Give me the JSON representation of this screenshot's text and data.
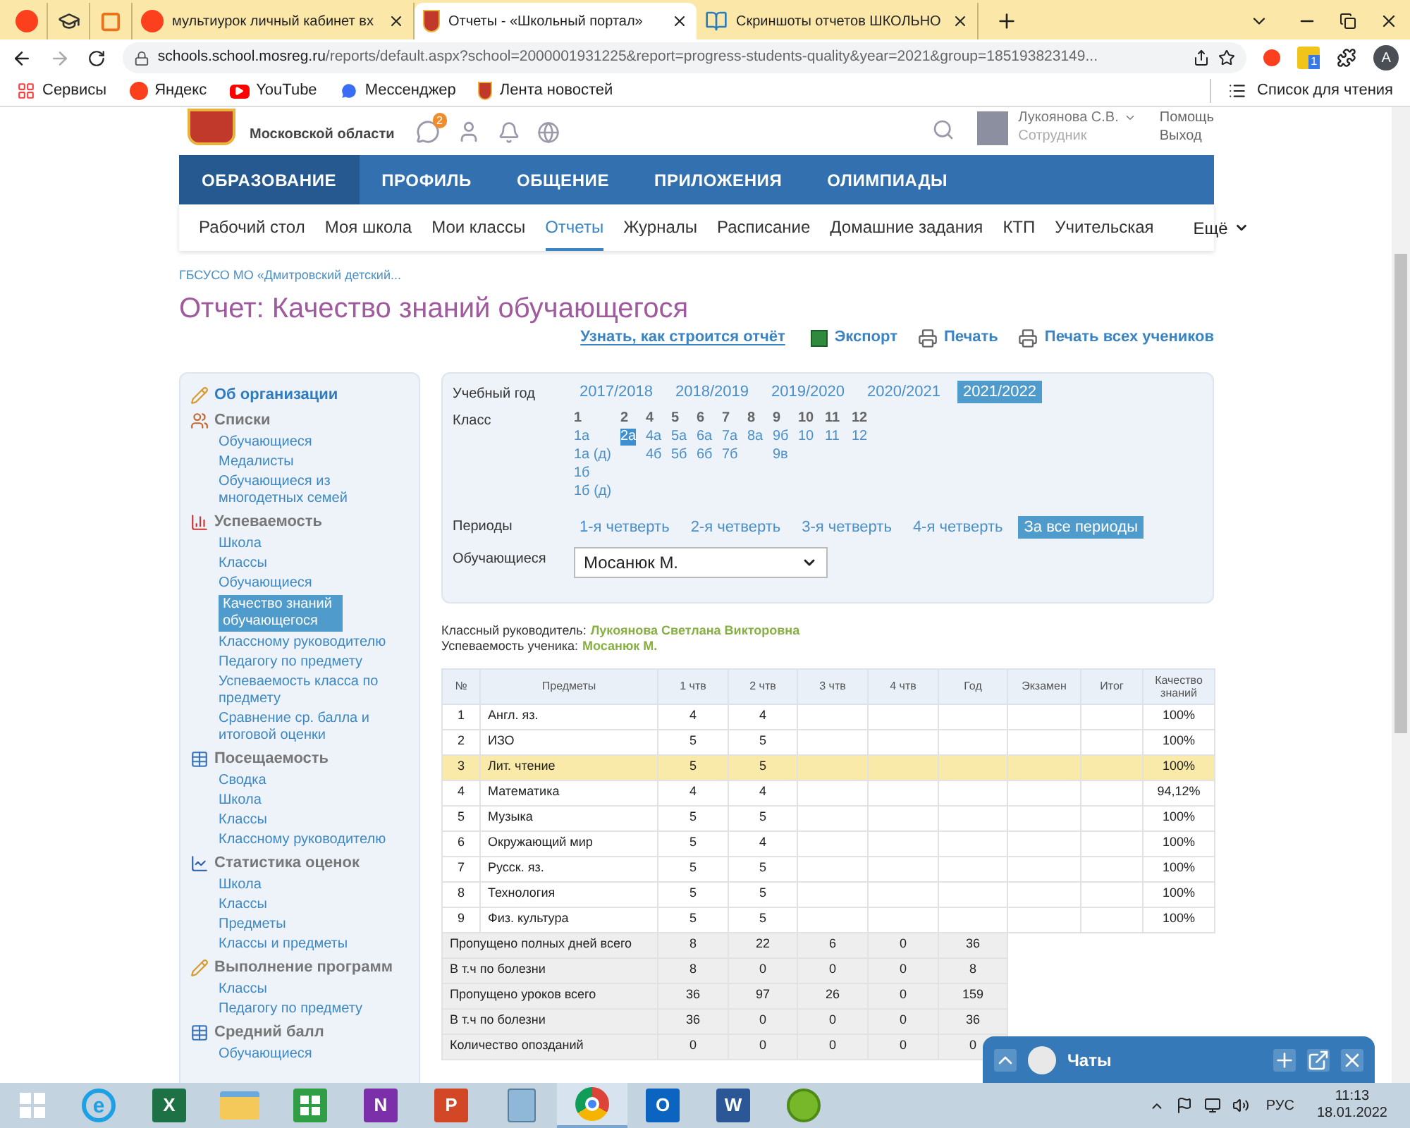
{
  "browser": {
    "tabs": [
      {
        "selected": false
      },
      {
        "selected": false
      },
      {
        "selected": false
      },
      {
        "title": "мультиурок личный кабинет вх",
        "selected": false
      },
      {
        "title": "Отчеты - «Школьный портал»",
        "selected": true
      },
      {
        "title": "Скриншоты отчетов ШКОЛЬНО",
        "selected": false
      }
    ],
    "address": {
      "host": "schools.school.mosreg.ru",
      "path": "/reports/default.aspx?school=2000001931225&report=progress-students-quality&year=2021&group=185193823149..."
    },
    "extension_badge": "1",
    "profile_letter": "A",
    "bookmarks": [
      "Сервисы",
      "Яндекс",
      "YouTube",
      "Мессенджер",
      "Лента новостей"
    ],
    "reading_list": "Список для чтения"
  },
  "header": {
    "region": "Московской области",
    "chat_badge": "2",
    "user": "Лукоянова С.В.",
    "role": "Сотрудник",
    "links": [
      "Помощь",
      "Выход"
    ]
  },
  "nav": [
    {
      "label": "ОБРАЗОВАНИЕ",
      "selected": true
    },
    {
      "label": "ПРОФИЛЬ",
      "selected": false
    },
    {
      "label": "ОБЩЕНИЕ",
      "selected": false
    },
    {
      "label": "ПРИЛОЖЕНИЯ",
      "selected": false
    },
    {
      "label": "ОЛИМПИАДЫ",
      "selected": false
    }
  ],
  "subnav": [
    {
      "label": "Рабочий стол",
      "selected": false
    },
    {
      "label": "Моя школа",
      "selected": false
    },
    {
      "label": "Мои классы",
      "selected": false
    },
    {
      "label": "Отчеты",
      "selected": true
    },
    {
      "label": "Журналы",
      "selected": false
    },
    {
      "label": "Расписание",
      "selected": false
    },
    {
      "label": "Домашние задания",
      "selected": false
    },
    {
      "label": "КТП",
      "selected": false
    },
    {
      "label": "Учительская",
      "selected": false
    }
  ],
  "subnav_more": "Ещё",
  "breadcrumb": "ГБСУСО МО «Дмитровский детский...",
  "title": "Отчет: Качество знаний обучающегося",
  "actions": [
    {
      "kind": "link",
      "label": "Узнать, как строится отчёт"
    },
    {
      "kind": "export",
      "label": "Экспорт"
    },
    {
      "kind": "print",
      "label": "Печать"
    },
    {
      "kind": "print",
      "label": "Печать всех учеников"
    }
  ],
  "sidebar": [
    {
      "kind": "link",
      "title": "Об организации"
    },
    {
      "kind": "group",
      "title": "Списки",
      "items": [
        {
          "label": "Обучающиеся",
          "selected": false
        },
        {
          "label": "Медалисты",
          "selected": false
        },
        {
          "label": "Обучающиеся из многодетных семей",
          "selected": false
        }
      ]
    },
    {
      "kind": "group",
      "title": "Успеваемость",
      "items": [
        {
          "label": "Школа",
          "selected": false
        },
        {
          "label": "Классы",
          "selected": false
        },
        {
          "label": "Обучающиеся",
          "selected": false
        },
        {
          "label": "Качество знаний обучающегося",
          "selected": true
        },
        {
          "label": "Классному руководителю",
          "selected": false
        },
        {
          "label": "Педагогу по предмету",
          "selected": false
        },
        {
          "label": "Успеваемость класса по предмету",
          "selected": false
        },
        {
          "label": "Сравнение ср. балла и итоговой оценки",
          "selected": false
        }
      ]
    },
    {
      "kind": "group",
      "title": "Посещаемость",
      "items": [
        {
          "label": "Сводка",
          "selected": false
        },
        {
          "label": "Школа",
          "selected": false
        },
        {
          "label": "Классы",
          "selected": false
        },
        {
          "label": "Классному руководителю",
          "selected": false
        }
      ]
    },
    {
      "kind": "group",
      "title": "Статистика оценок",
      "items": [
        {
          "label": "Школа",
          "selected": false
        },
        {
          "label": "Классы",
          "selected": false
        },
        {
          "label": "Предметы",
          "selected": false
        },
        {
          "label": "Классы и предметы",
          "selected": false
        }
      ]
    },
    {
      "kind": "group",
      "title": "Выполнение программ",
      "items": [
        {
          "label": "Классы",
          "selected": false
        },
        {
          "label": "Педагогу по предмету",
          "selected": false
        }
      ]
    },
    {
      "kind": "group",
      "title": "Средний балл",
      "items": [
        {
          "label": "Обучающиеся",
          "selected": false
        }
      ]
    }
  ],
  "filters": {
    "year": {
      "label": "Учебный год",
      "options": [
        {
          "label": "2017/2018",
          "selected": false
        },
        {
          "label": "2018/2019",
          "selected": false
        },
        {
          "label": "2019/2020",
          "selected": false
        },
        {
          "label": "2020/2021",
          "selected": false
        },
        {
          "label": "2021/2022",
          "selected": true
        }
      ]
    },
    "class": {
      "label": "Класс",
      "grades": [
        {
          "grade": "1",
          "groups": [
            {
              "label": "1а",
              "selected": false
            },
            {
              "label": "1а (д)",
              "selected": false
            },
            {
              "label": "1б",
              "selected": false
            },
            {
              "label": "1б (д)",
              "selected": false
            }
          ]
        },
        {
          "grade": "2",
          "groups": [
            {
              "label": "2а",
              "selected": true
            }
          ]
        },
        {
          "grade": "4",
          "groups": [
            {
              "label": "4а",
              "selected": false
            },
            {
              "label": "4б",
              "selected": false
            }
          ]
        },
        {
          "grade": "5",
          "groups": [
            {
              "label": "5а",
              "selected": false
            },
            {
              "label": "5б",
              "selected": false
            }
          ]
        },
        {
          "grade": "6",
          "groups": [
            {
              "label": "6а",
              "selected": false
            },
            {
              "label": "6б",
              "selected": false
            }
          ]
        },
        {
          "grade": "7",
          "groups": [
            {
              "label": "7а",
              "selected": false
            },
            {
              "label": "7б",
              "selected": false
            }
          ]
        },
        {
          "grade": "8",
          "groups": [
            {
              "label": "8а",
              "selected": false
            }
          ]
        },
        {
          "grade": "9",
          "groups": [
            {
              "label": "9б",
              "selected": false
            },
            {
              "label": "9в",
              "selected": false
            }
          ]
        },
        {
          "grade": "10",
          "groups": [
            {
              "label": "10",
              "selected": false
            }
          ]
        },
        {
          "grade": "11",
          "groups": [
            {
              "label": "11",
              "selected": false
            }
          ]
        },
        {
          "grade": "12",
          "groups": [
            {
              "label": "12",
              "selected": false
            }
          ]
        }
      ]
    },
    "periods": {
      "label": "Периоды",
      "options": [
        {
          "label": "1-я четверть",
          "selected": false
        },
        {
          "label": "2-я четверть",
          "selected": false
        },
        {
          "label": "3-я четверть",
          "selected": false
        },
        {
          "label": "4-я четверть",
          "selected": false
        },
        {
          "label": "За все периоды",
          "selected": true
        }
      ]
    },
    "student": {
      "label": "Обучающиеся",
      "value": "Мосанюк М."
    }
  },
  "info": [
    {
      "label": "Классный руководитель:",
      "value": "Лукоянова Светлана Викторовна"
    },
    {
      "label": "Успеваемость ученика:",
      "value": "Мосанюк М."
    }
  ],
  "table": {
    "columns": [
      "№",
      "Предметы",
      "1 чтв",
      "2 чтв",
      "3 чтв",
      "4 чтв",
      "Год",
      "Экзамен",
      "Итог",
      "Качество знаний"
    ],
    "rows": [
      {
        "no": "1",
        "subject": "Англ. яз.",
        "marks": [
          "4",
          "4"
        ],
        "quality": "100%",
        "selected": false
      },
      {
        "no": "2",
        "subject": "ИЗО",
        "marks": [
          "5",
          "5"
        ],
        "quality": "100%",
        "selected": false
      },
      {
        "no": "3",
        "subject": "Лит. чтение",
        "marks": [
          "5",
          "5"
        ],
        "quality": "100%",
        "selected": true
      },
      {
        "no": "4",
        "subject": "Математика",
        "marks": [
          "4",
          "4"
        ],
        "quality": "94,12%",
        "selected": false
      },
      {
        "no": "5",
        "subject": "Музыка",
        "marks": [
          "5",
          "5"
        ],
        "quality": "100%",
        "selected": false
      },
      {
        "no": "6",
        "subject": "Окружающий мир",
        "marks": [
          "5",
          "4"
        ],
        "quality": "100%",
        "selected": false
      },
      {
        "no": "7",
        "subject": "Русск. яз.",
        "marks": [
          "5",
          "5"
        ],
        "quality": "100%",
        "selected": false
      },
      {
        "no": "8",
        "subject": "Технология",
        "marks": [
          "5",
          "5"
        ],
        "quality": "100%",
        "selected": false
      },
      {
        "no": "9",
        "subject": "Физ. культура",
        "marks": [
          "5",
          "5"
        ],
        "quality": "100%",
        "selected": false
      }
    ],
    "summary": [
      {
        "label": "Пропущено полных дней всего",
        "values": [
          "8",
          "22",
          "6",
          "0",
          "36"
        ]
      },
      {
        "label": "В т.ч по болезни",
        "values": [
          "8",
          "0",
          "0",
          "0",
          "8"
        ]
      },
      {
        "label": "Пропущено уроков всего",
        "values": [
          "36",
          "97",
          "26",
          "0",
          "159"
        ]
      },
      {
        "label": "В т.ч по болезни",
        "values": [
          "36",
          "0",
          "0",
          "0",
          "36"
        ]
      },
      {
        "label": "Количество опозданий",
        "values": [
          "0",
          "0",
          "0",
          "0",
          "0"
        ]
      }
    ]
  },
  "chat": {
    "title": "Чаты"
  },
  "taskbar": {
    "apps": [
      {
        "kind": "ring",
        "glyph": "e",
        "selected": false
      },
      {
        "kind": "tile",
        "glyph": "X",
        "selected": false
      },
      {
        "kind": "folder",
        "selected": false
      },
      {
        "kind": "store",
        "selected": false
      },
      {
        "kind": "tile",
        "glyph": "N",
        "selected": false
      },
      {
        "kind": "tile",
        "glyph": "P",
        "selected": false
      },
      {
        "kind": "calculator",
        "selected": false
      },
      {
        "kind": "browser",
        "selected": true
      },
      {
        "kind": "tile",
        "glyph": "O",
        "selected": false
      },
      {
        "kind": "tile",
        "glyph": "W",
        "selected": false
      },
      {
        "kind": "torrent",
        "selected": false
      }
    ],
    "lang": "РУС",
    "time": "11:13",
    "date": "18.01.2022"
  }
}
